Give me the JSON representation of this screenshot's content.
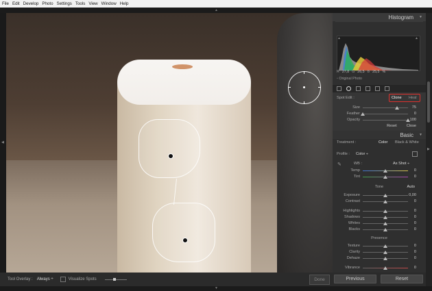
{
  "menu": [
    "File",
    "Edit",
    "Develop",
    "Photo",
    "Settings",
    "Tools",
    "View",
    "Window",
    "Help"
  ],
  "histogram": {
    "title": "Histogram",
    "readout": {
      "r_label": "R",
      "r": "27,8",
      "g_label": "G",
      "g": "26,5",
      "b_label": "B",
      "b": "25,5",
      "unit": "%"
    },
    "original_photo": "Original Photo"
  },
  "spot_edit": {
    "title": "Spot Edit :",
    "mode_clone": "Clone",
    "mode_heal": "Heal",
    "sliders": [
      {
        "label": "Size",
        "value": "75",
        "fraction": 0.75
      },
      {
        "label": "Feather",
        "value": "0",
        "fraction": 0.0
      },
      {
        "label": "Opacity",
        "value": "100",
        "fraction": 1.0
      }
    ],
    "reset": "Reset",
    "close": "Close"
  },
  "basic": {
    "title": "Basic",
    "treatment_label": "Treatment :",
    "treatment_color": "Color",
    "treatment_bw": "Black & White",
    "profile_label": "Profile :",
    "profile_value": "Color ÷",
    "wb_label": "WB :",
    "wb_value": "As Shot ÷",
    "wb_sliders": [
      {
        "label": "Temp",
        "value": "0",
        "fraction": 0.5
      },
      {
        "label": "Tint",
        "value": "0",
        "fraction": 0.5
      }
    ],
    "tone_label": "Tone",
    "auto_label": "Auto",
    "tone_sliders": [
      {
        "label": "Exposure",
        "value": "0,00",
        "fraction": 0.5
      },
      {
        "label": "Contrast",
        "value": "0",
        "fraction": 0.5
      },
      {
        "label": "Highlights",
        "value": "0",
        "fraction": 0.5
      },
      {
        "label": "Shadows",
        "value": "0",
        "fraction": 0.5
      },
      {
        "label": "Whites",
        "value": "0",
        "fraction": 0.5
      },
      {
        "label": "Blacks",
        "value": "0",
        "fraction": 0.5
      }
    ],
    "presence_label": "Presence",
    "presence_sliders": [
      {
        "label": "Texture",
        "value": "0",
        "fraction": 0.5
      },
      {
        "label": "Clarity",
        "value": "0",
        "fraction": 0.5
      },
      {
        "label": "Dehaze",
        "value": "0",
        "fraction": 0.5
      },
      {
        "label": "Vibrance",
        "value": "0",
        "fraction": 0.5
      }
    ]
  },
  "toolbar": {
    "overlay_label": "Tool Overlay :",
    "overlay_value": "Always ÷",
    "visualize_label": "Visualize Spots",
    "done": "Done"
  },
  "buttons": {
    "previous": "Previous",
    "reset": "Reset"
  },
  "colors": {
    "highlight_box": "#e0312e",
    "panel_bg": "#2f2f2f",
    "active_text": "#ffffff"
  }
}
